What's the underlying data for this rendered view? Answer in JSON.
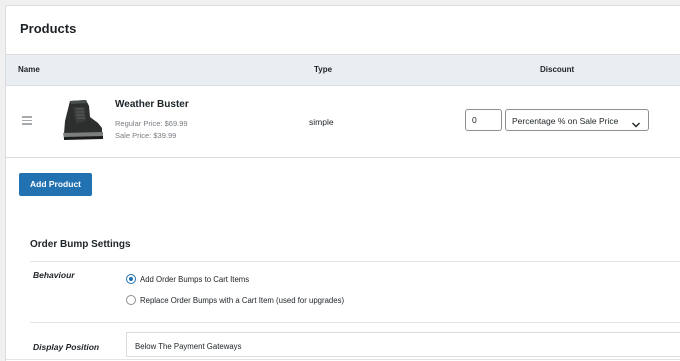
{
  "products": {
    "title": "Products",
    "columns": {
      "name": "Name",
      "type": "Type",
      "discount": "Discount"
    },
    "items": [
      {
        "name": "Weather Buster",
        "regular_price": "Regular Price: $69.99",
        "sale_price": "Sale Price: $39.99",
        "type": "simple",
        "discount_value": "0",
        "discount_type": "Percentage % on Sale Price",
        "image_icon": "boot-icon"
      }
    ],
    "add_button": "Add Product"
  },
  "order_bump": {
    "title": "Order Bump Settings",
    "behaviour_label": "Behaviour",
    "behaviour_options": [
      {
        "label": "Add Order Bumps to Cart Items",
        "checked": true
      },
      {
        "label": "Replace Order Bumps with a Cart Item (used for upgrades)",
        "checked": false
      }
    ],
    "display_position_label": "Display Position",
    "display_position_value": "Below The Payment Gateways"
  },
  "colors": {
    "primary": "#2271b1",
    "header_bg": "#e9eef3",
    "page_bg": "#f0f0f1"
  }
}
